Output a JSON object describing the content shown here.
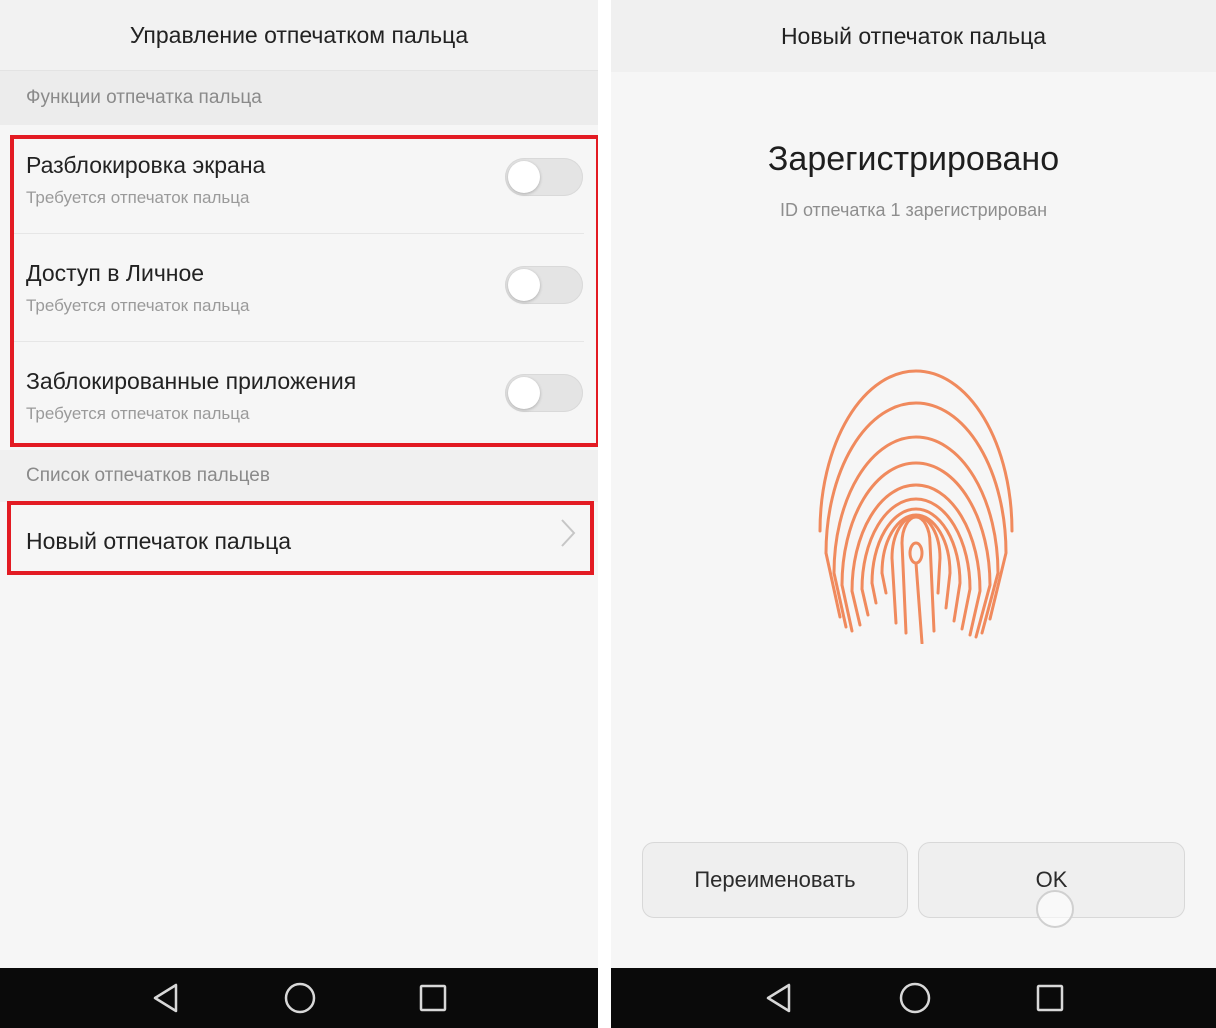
{
  "left": {
    "title": "Управление отпечатком пальца",
    "section_functions": "Функции отпечатка пальца",
    "toggles": [
      {
        "title": "Разблокировка экрана",
        "subtitle": "Требуется отпечаток пальца",
        "enabled": false
      },
      {
        "title": "Доступ в Личное",
        "subtitle": "Требуется отпечаток пальца",
        "enabled": false
      },
      {
        "title": "Заблокированные приложения",
        "subtitle": "Требуется отпечаток пальца",
        "enabled": false
      }
    ],
    "section_list": "Список отпечатков пальцев",
    "new_fingerprint": "Новый отпечаток пальца",
    "highlight_color": "#e31b23"
  },
  "right": {
    "title": "Новый отпечаток пальца",
    "status": "Зарегистрировано",
    "status_sub": "ID отпечатка 1 зарегистрирован",
    "fingerprint_color": "#f08a5d",
    "rename_button": "Переименовать",
    "ok_button": "OK"
  },
  "navbar": {
    "icons": [
      "back-icon",
      "home-icon",
      "recents-icon"
    ]
  }
}
